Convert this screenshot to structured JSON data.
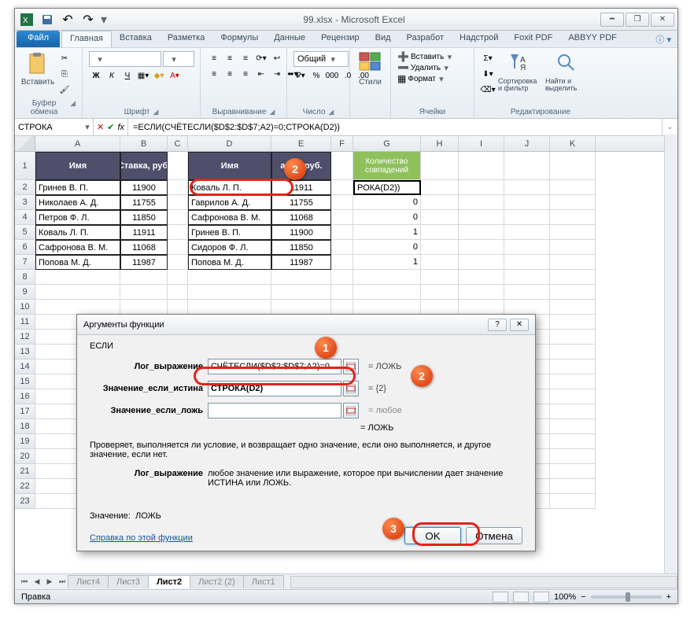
{
  "title": "99.xlsx - Microsoft Excel",
  "tabs": {
    "file": "Файл",
    "home": "Главная",
    "insert": "Вставка",
    "layout": "Разметка",
    "formulas": "Формулы",
    "data": "Данные",
    "review": "Рецензир",
    "view": "Вид",
    "dev": "Разработ",
    "addins": "Надстрой",
    "foxit": "Foxit PDF",
    "abbyy": "ABBYY PDF"
  },
  "ribbon": {
    "clipboard": {
      "paste": "Вставить",
      "label": "Буфер обмена"
    },
    "font": {
      "name": "",
      "size": "",
      "label": "Шрифт",
      "bold": "Ж",
      "italic": "К",
      "underline": "Ч"
    },
    "alignment": {
      "label": "Выравнивание"
    },
    "number": {
      "format": "Общий",
      "label": "Число"
    },
    "styles": {
      "btn": "Стили",
      "label": ""
    },
    "cells": {
      "insert": "Вставить",
      "delete": "Удалить",
      "format": "Формат",
      "label": "Ячейки"
    },
    "editing": {
      "sort": "Сортировка и фильтр",
      "find": "Найти и выделить",
      "label": "Редактирование"
    }
  },
  "namebox": "СТРОКА",
  "formula": "=ЕСЛИ(СЧЁТЕСЛИ($D$2:$D$7;A2)=0;СТРОКА(D2))",
  "cols": [
    "A",
    "B",
    "C",
    "D",
    "E",
    "F",
    "G",
    "H",
    "I",
    "J",
    "K"
  ],
  "headers": {
    "A": "Имя",
    "B": "Ставка, руб.",
    "D": "Имя",
    "E": "авка, руб.",
    "G": "Количество совпадений"
  },
  "rows": [
    {
      "n": 2,
      "A": "Гринев В. П.",
      "B": "11900",
      "D": "Коваль Л. П.",
      "E": "11911",
      "G": "РОКА(D2))"
    },
    {
      "n": 3,
      "A": "Николаев А. Д.",
      "B": "11755",
      "D": "Гаврилов А. Д.",
      "E": "11755",
      "G": "0"
    },
    {
      "n": 4,
      "A": "Петров Ф. Л.",
      "B": "11850",
      "D": "Сафронова В. М.",
      "E": "11068",
      "G": "0"
    },
    {
      "n": 5,
      "A": "Коваль Л. П.",
      "B": "11911",
      "D": "Гринев В. П.",
      "E": "11900",
      "G": "1"
    },
    {
      "n": 6,
      "A": "Сафронова В. М.",
      "B": "11068",
      "D": "Сидоров Ф. Л.",
      "E": "11850",
      "G": "0"
    },
    {
      "n": 7,
      "A": "Попова М. Д.",
      "B": "11987",
      "D": "Попова М. Д.",
      "E": "11987",
      "G": "1"
    }
  ],
  "emptyRows": [
    "8",
    "9",
    "10",
    "11",
    "12",
    "13",
    "14",
    "15",
    "16",
    "17",
    "18",
    "19",
    "20",
    "21",
    "22",
    "23"
  ],
  "dialog": {
    "title": "Аргументы функции",
    "func": "ЕСЛИ",
    "arg1_label": "Лог_выражение",
    "arg1_value": "СЧЁТЕСЛИ($D$2:$D$7;A2)=0",
    "arg1_result": "=   ЛОЖЬ",
    "arg2_label": "Значение_если_истина",
    "arg2_value": "СТРОКА(D2)",
    "arg2_result": "=   {2}",
    "arg3_label": "Значение_если_ложь",
    "arg3_value": "",
    "arg3_result": "=   любое",
    "overall": "=   ЛОЖЬ",
    "desc": "Проверяет, выполняется ли условие, и возвращает одно значение, если оно выполняется, и другое значение, если нет.",
    "argdesc_label": "Лог_выражение",
    "argdesc_text": "любое значение или выражение, которое при вычислении дает значение ИСТИНА или ЛОЖЬ.",
    "value_label": "Значение:",
    "value": "ЛОЖЬ",
    "help": "Справка по этой функции",
    "ok": "OK",
    "cancel": "Отмена"
  },
  "sheets": {
    "nav": [
      "⏮",
      "◀",
      "▶",
      "⏭"
    ],
    "s1": "Лист4",
    "s2": "Лист3",
    "s3": "Лист2",
    "s4": "Лист2 (2)",
    "s5": "Лист1"
  },
  "status": {
    "mode": "Правка",
    "zoom": "100%"
  },
  "callouts": {
    "c1": "1",
    "c2_top": "2",
    "c2_dlg": "2",
    "c3": "3"
  }
}
